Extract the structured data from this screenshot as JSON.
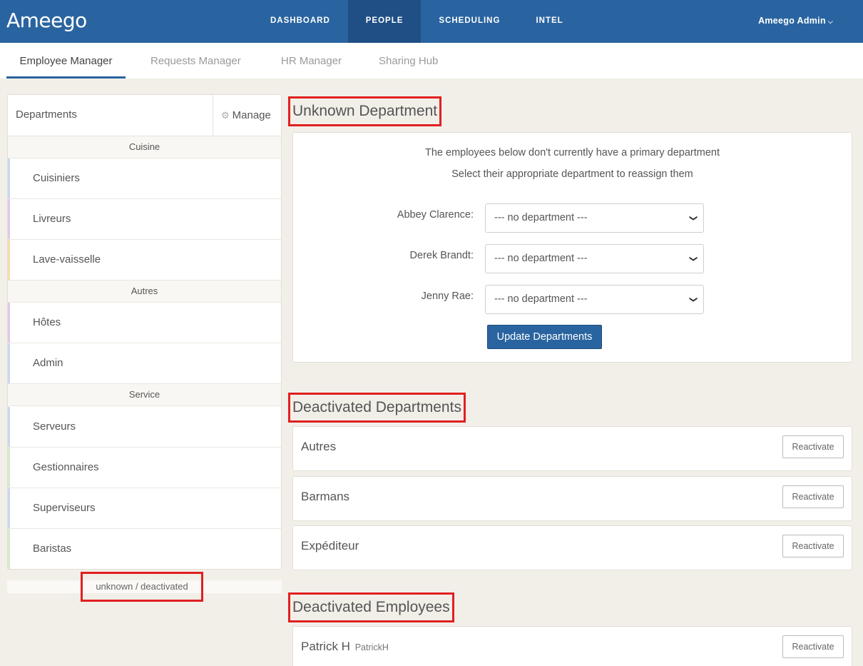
{
  "app": {
    "logo": "Ameego"
  },
  "nav": {
    "items": [
      {
        "label": "DASHBOARD"
      },
      {
        "label": "PEOPLE"
      },
      {
        "label": "SCHEDULING"
      },
      {
        "label": "INTEL"
      }
    ],
    "active": "PEOPLE",
    "user": "Ameego Admin"
  },
  "subnav": {
    "tabs": [
      {
        "label": "Employee Manager"
      },
      {
        "label": "Requests Manager"
      },
      {
        "label": "HR Manager"
      },
      {
        "label": "Sharing Hub"
      }
    ],
    "active": "Employee Manager"
  },
  "sidebar": {
    "title": "Departments",
    "manage_label": "Manage",
    "groups": [
      {
        "label": "Cuisine",
        "departments": [
          {
            "name": "Cuisiniers",
            "color": "#c5daf0"
          },
          {
            "name": "Livreurs",
            "color": "#e3c6ea"
          },
          {
            "name": "Lave-vaisselle",
            "color": "#f8dcae"
          }
        ]
      },
      {
        "label": "Autres",
        "departments": [
          {
            "name": "Hôtes",
            "color": "#e3c6ea"
          },
          {
            "name": "Admin",
            "color": "#c5daf0"
          }
        ]
      },
      {
        "label": "Service",
        "departments": [
          {
            "name": "Serveurs",
            "color": "#c5daf0"
          },
          {
            "name": "Gestionnaires",
            "color": "#d6ebc9"
          },
          {
            "name": "Superviseurs",
            "color": "#c5daf0"
          },
          {
            "name": "Baristas",
            "color": "#d6ebc9"
          }
        ]
      }
    ],
    "unknown_link": "unknown / deactivated"
  },
  "unknown_department": {
    "heading": "Unknown Department",
    "message_line1": "The employees below don't currently have a primary department",
    "message_line2": "Select their appropriate department to reassign them",
    "employees": [
      {
        "label": "Abbey Clarence:",
        "selected": "--- no department ---"
      },
      {
        "label": "Derek Brandt:",
        "selected": "--- no department ---"
      },
      {
        "label": "Jenny Rae:",
        "selected": "--- no department ---"
      }
    ],
    "update_button": "Update Departments"
  },
  "deactivated_departments": {
    "heading": "Deactivated Departments",
    "items": [
      {
        "name": "Autres",
        "action": "Reactivate"
      },
      {
        "name": "Barmans",
        "action": "Reactivate"
      },
      {
        "name": "Expéditeur",
        "action": "Reactivate"
      }
    ]
  },
  "deactivated_employees": {
    "heading": "Deactivated Employees",
    "items": [
      {
        "name": "Patrick H",
        "username": "PatrickH",
        "action": "Reactivate"
      }
    ]
  }
}
